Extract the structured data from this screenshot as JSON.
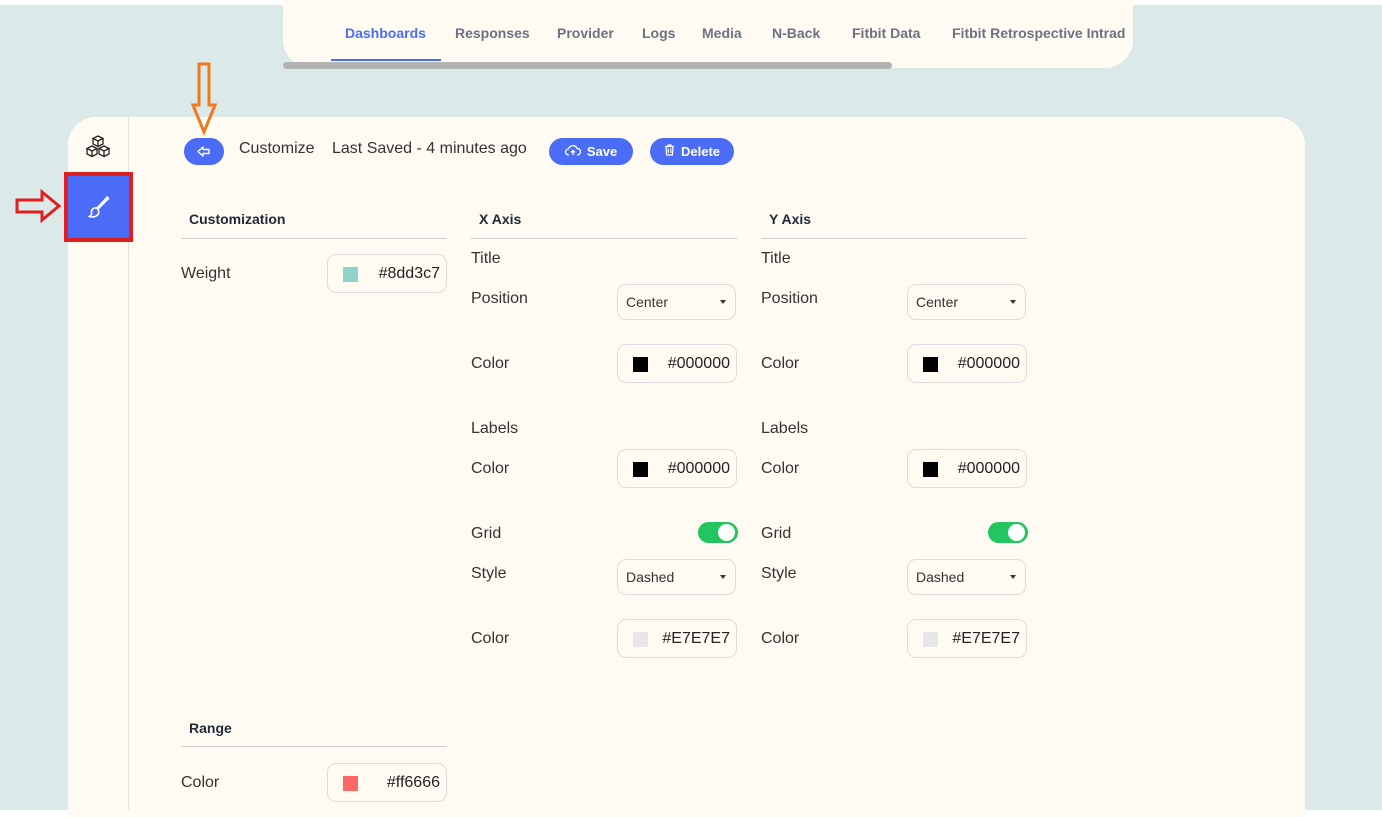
{
  "nav": {
    "tabs": [
      "Dashboards",
      "Responses",
      "Provider",
      "Logs",
      "Media",
      "N-Back",
      "Fitbit Data",
      "Fitbit Retrospective Intrad"
    ],
    "active_index": 0
  },
  "header": {
    "title": "Customize",
    "last_saved": "Last Saved - 4 minutes ago",
    "save_label": "Save",
    "delete_label": "Delete"
  },
  "customization": {
    "section_title": "Customization",
    "weight_label": "Weight",
    "weight_color": "#8dd3c7"
  },
  "x_axis": {
    "section_title": "X Axis",
    "title_label": "Title",
    "position_label": "Position",
    "position_value": "Center",
    "title_color_label": "Color",
    "title_color": "#000000",
    "labels_label": "Labels",
    "labels_color_label": "Color",
    "labels_color": "#000000",
    "grid_label": "Grid",
    "grid_enabled": true,
    "style_label": "Style",
    "style_value": "Dashed",
    "grid_color_label": "Color",
    "grid_color": "#E7E7E7"
  },
  "y_axis": {
    "section_title": "Y Axis",
    "title_label": "Title",
    "position_label": "Position",
    "position_value": "Center",
    "title_color_label": "Color",
    "title_color": "#000000",
    "labels_label": "Labels",
    "labels_color_label": "Color",
    "labels_color": "#000000",
    "grid_label": "Grid",
    "grid_enabled": true,
    "style_label": "Style",
    "style_value": "Dashed",
    "grid_color_label": "Color",
    "grid_color": "#E7E7E7"
  },
  "range": {
    "section_title": "Range",
    "color_label": "Color",
    "color": "#ff6666"
  },
  "sidebar": {
    "items": [
      {
        "icon": "cubes-icon"
      },
      {
        "icon": "paintbrush-icon",
        "active": true
      }
    ]
  },
  "colors": {
    "accent": "#4a6cf7",
    "toggle_on": "#22c55e",
    "annotation_red": "#e02020",
    "annotation_orange": "#f07820"
  }
}
